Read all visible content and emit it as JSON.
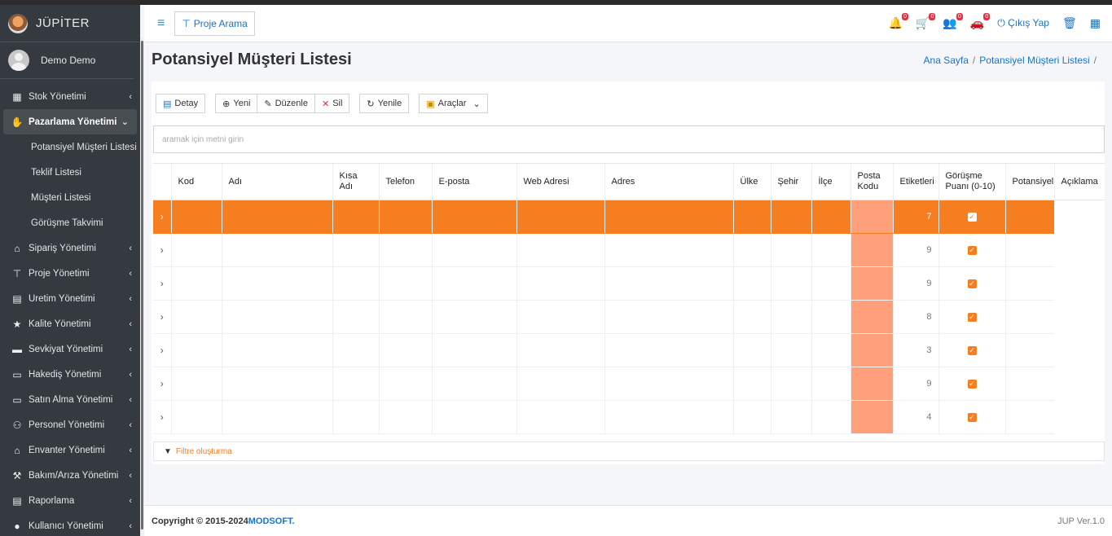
{
  "brand": {
    "name": "JÜPİTER"
  },
  "user": {
    "name": "Demo Demo"
  },
  "sidebar": {
    "items": [
      {
        "label": "Stok Yönetimi",
        "icon": "boxes-icon"
      },
      {
        "label": "Pazarlama Yönetimi",
        "icon": "handshake-icon"
      },
      {
        "label": "Sipariş Yönetimi",
        "icon": "store-icon"
      },
      {
        "label": "Proje Yönetimi",
        "icon": "sitemap-icon"
      },
      {
        "label": "Üretim Yönetimi",
        "icon": "factory-icon"
      },
      {
        "label": "Kalite Yönetimi",
        "icon": "star-icon"
      },
      {
        "label": "Sevkiyat Yönetimi",
        "icon": "truck-icon"
      },
      {
        "label": "Hakediş Yönetimi",
        "icon": "money-icon"
      },
      {
        "label": "Satın Alma Yönetimi",
        "icon": "credit-card-icon"
      },
      {
        "label": "Personel Yönetimi",
        "icon": "people-icon"
      },
      {
        "label": "Envanter Yönetimi",
        "icon": "warehouse-icon"
      },
      {
        "label": "Bakım/Arıza Yönetimi",
        "icon": "wrench-icon"
      },
      {
        "label": "Raporlama",
        "icon": "report-icon"
      },
      {
        "label": "Kullanıcı Yönetimi",
        "icon": "user-icon"
      }
    ],
    "submenu": [
      "Potansiyel Müşteri Listesi",
      "Teklif Listesi",
      "Müşteri Listesi",
      "Görüşme Takvimi"
    ]
  },
  "topbar": {
    "project_search": "Proje Arama",
    "badges": [
      "0",
      "0",
      "0",
      "0"
    ],
    "logout": "Çıkış Yap"
  },
  "page": {
    "title": "Potansiyel Müşteri Listesi",
    "breadcrumb": [
      "Ana Sayfa",
      "Potansiyel Müşteri Listesi"
    ]
  },
  "toolbar": {
    "detail": "Detay",
    "new": "Yeni",
    "edit": "Düzenle",
    "delete": "Sil",
    "refresh": "Yenile",
    "tools": "Araçlar"
  },
  "search": {
    "placeholder": "aramak için metni girin"
  },
  "table": {
    "columns": [
      "Kod",
      "Adı",
      "Kısa Adı",
      "Telefon",
      "E-posta",
      "Web Adresi",
      "Adres",
      "Ülke",
      "Şehir",
      "İlçe",
      "Posta Kodu",
      "Etiketleri",
      "Görüşme Puanı (0-10)",
      "Potansiyel",
      "Açıklama"
    ],
    "rows": [
      {
        "score": "7",
        "potential": true,
        "selected": true
      },
      {
        "score": "9",
        "potential": true
      },
      {
        "score": "9",
        "potential": true
      },
      {
        "score": "8",
        "potential": true
      },
      {
        "score": "3",
        "potential": true
      },
      {
        "score": "9",
        "potential": true
      },
      {
        "score": "4",
        "potential": true
      }
    ]
  },
  "filter": {
    "label": "Filtre oluşturma"
  },
  "footer": {
    "copyright": "Copyright © 2015-2024 ",
    "company": "MODSOFT.",
    "version": "JUP Ver.1.0"
  },
  "colors": {
    "accent": "#f47e20",
    "tag": "#ffa07a",
    "link": "#1a73c8",
    "sidebar": "#343a40"
  }
}
